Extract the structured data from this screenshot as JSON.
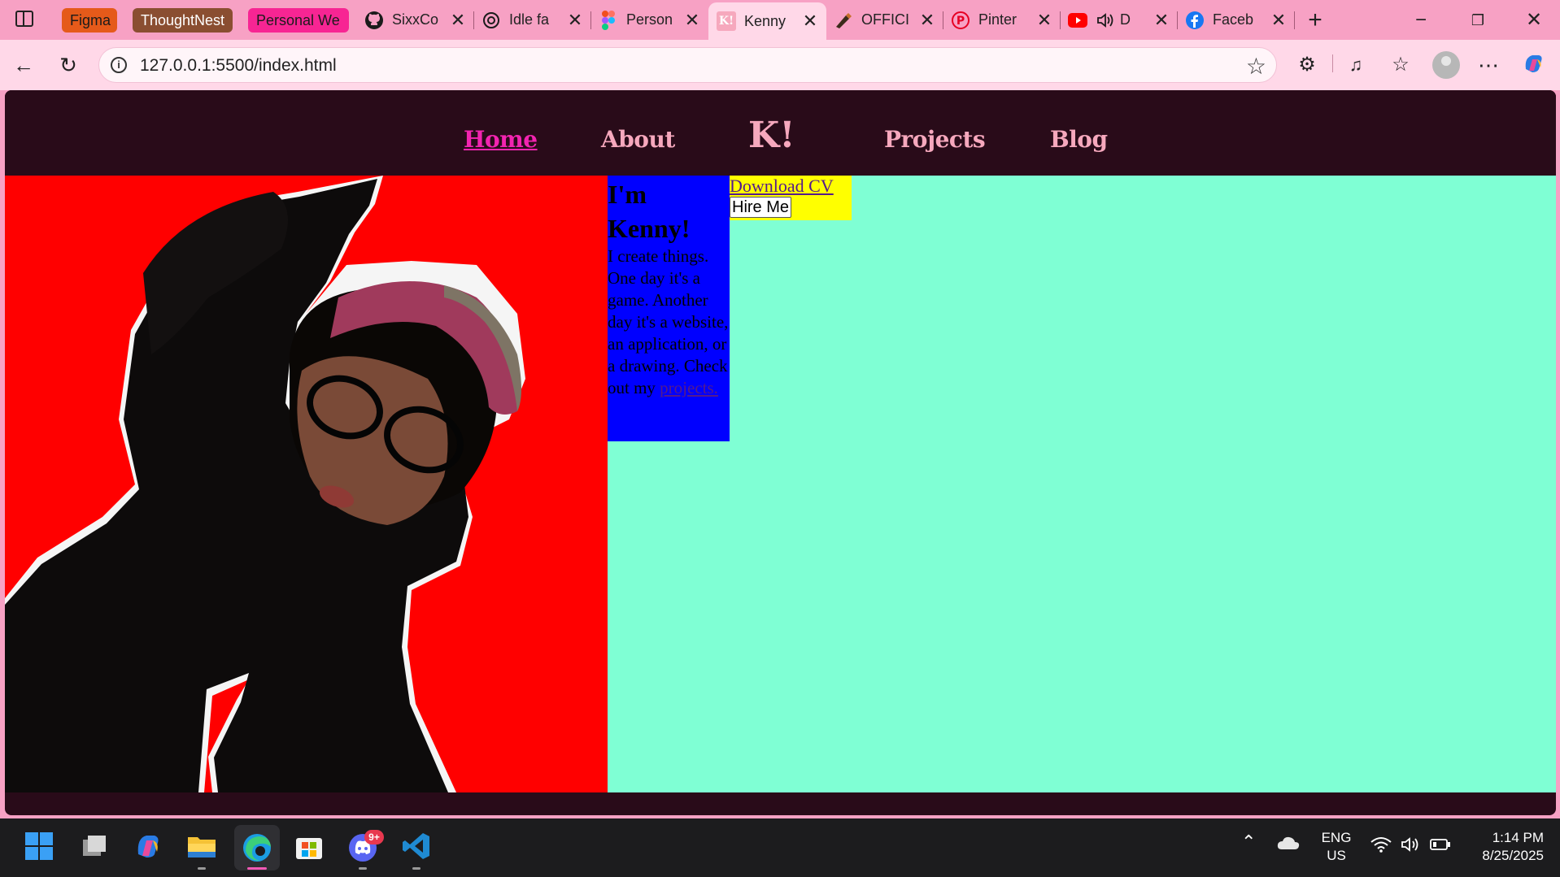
{
  "browser": {
    "tab_groups": [
      {
        "label": "Figma",
        "color": "#e55a1a"
      },
      {
        "label": "ThoughtNest",
        "color": "#8a4e31"
      },
      {
        "label": "Personal We",
        "color": "#f72593"
      }
    ],
    "tabs": [
      {
        "title": "SixxCo",
        "icon": "github-icon"
      },
      {
        "title": "Idle fa",
        "icon": "openai-icon"
      },
      {
        "title": "Person",
        "icon": "figma-icon"
      },
      {
        "title": "Kenny",
        "icon": "kenny-site-icon",
        "favicon_text": "K!",
        "active": true
      },
      {
        "title": "OFFICI",
        "icon": "pencil-logo-icon"
      },
      {
        "title": "Pinter",
        "icon": "pinterest-icon"
      },
      {
        "title": "D",
        "icon": "youtube-icon"
      },
      {
        "title": "Faceb",
        "icon": "facebook-icon"
      }
    ],
    "url": "127.0.0.1:5500/index.html"
  },
  "site": {
    "nav": {
      "home": "Home",
      "about": "About",
      "logo": "K!",
      "projects": "Projects",
      "blog": "Blog"
    },
    "hero": {
      "heading": "I'm Kenny!",
      "text": "I create things. One day it's a game. Another day it's a website, an application, or a drawing. Check out my",
      "link": "projects.",
      "download_cv": "Download CV",
      "hire_me": "Hire Me"
    },
    "colors": {
      "nav_bg": "#290b19",
      "nav_link": "#f6a8bd",
      "nav_active": "#f224b0",
      "hero_bg": "#7fffd4",
      "photo_bg": "#ff0000",
      "intro_bg": "#0000ff",
      "cta_bg": "#ffff00"
    }
  },
  "taskbar": {
    "discord_badge": "9+",
    "language": "ENG",
    "region": "US",
    "time": "1:14 PM",
    "date": "8/25/2025"
  }
}
